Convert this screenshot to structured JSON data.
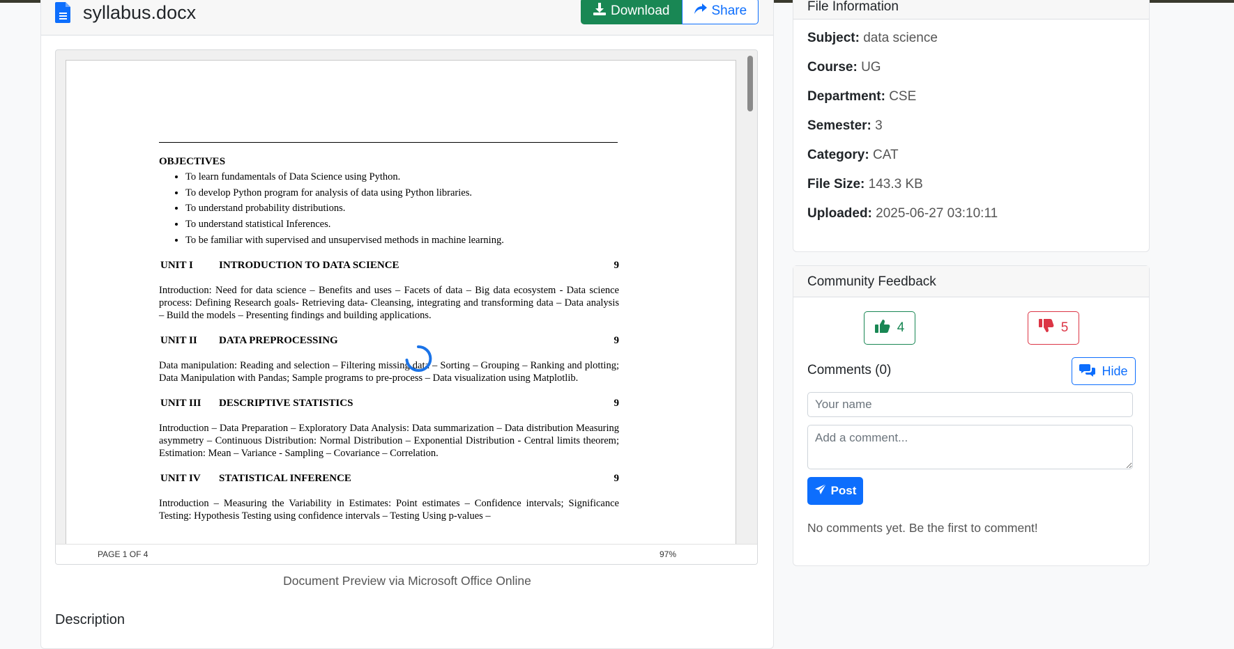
{
  "file": {
    "name": "syllabus.docx",
    "download_label": "Download",
    "share_label": "Share"
  },
  "document": {
    "objectives_title": "OBJECTIVES",
    "objectives": [
      "To learn fundamentals of Data Science using Python.",
      "To develop Python program for analysis of data using Python libraries.",
      "To understand probability distributions.",
      "To understand statistical Inferences.",
      "To be familiar with supervised and unsupervised methods in machine learning."
    ],
    "units": [
      {
        "number": "UNIT I",
        "title": "INTRODUCTION TO DATA SCIENCE",
        "hours": "9",
        "body": "Introduction: Need for data science – Benefits and uses – Facets of data – Big data ecosystem - Data science process: Defining Research goals- Retrieving data- Cleansing, integrating and transforming data – Data analysis – Build the models – Presenting findings and building applications."
      },
      {
        "number": "UNIT II",
        "title": "DATA PREPROCESSING",
        "hours": "9",
        "body": "Data manipulation: Reading and selection – Filtering missing data – Sorting – Grouping – Ranking and plotting; Data Manipulation with Pandas; Sample programs to pre-process – Data visualization using Matplotlib."
      },
      {
        "number": "UNIT III",
        "title": "DESCRIPTIVE STATISTICS",
        "hours": "9",
        "body": "Introduction – Data Preparation – Exploratory Data Analysis: Data summarization – Data distribution Measuring asymmetry – Continuous Distribution: Normal Distribution – Exponential Distribution - Central limits theorem; Estimation: Mean – Variance - Sampling – Covariance – Correlation."
      },
      {
        "number": "UNIT IV",
        "title": "STATISTICAL INFERENCE",
        "hours": "9",
        "body": "Introduction – Measuring the Variability in Estimates: Point estimates – Confidence intervals; Significance Testing: Hypothesis Testing using confidence intervals – Testing Using p-values –"
      }
    ]
  },
  "viewer": {
    "page_indicator": "PAGE 1 OF 4",
    "zoom": "97%",
    "preview_note": "Document Preview via Microsoft Office Online"
  },
  "description_heading": "Description",
  "file_info": {
    "header": "File Information",
    "rows": [
      {
        "label": "Subject:",
        "value": "data science"
      },
      {
        "label": "Course:",
        "value": "UG"
      },
      {
        "label": "Department:",
        "value": "CSE"
      },
      {
        "label": "Semester:",
        "value": "3"
      },
      {
        "label": "Category:",
        "value": "CAT"
      },
      {
        "label": "File Size:",
        "value": "143.3 KB"
      },
      {
        "label": "Uploaded:",
        "value": "2025-06-27 03:10:11"
      }
    ]
  },
  "feedback": {
    "header": "Community Feedback",
    "likes": "4",
    "dislikes": "5",
    "comments_label": "Comments (0)",
    "hide_label": "Hide",
    "name_placeholder": "Your name",
    "comment_placeholder": "Add a comment...",
    "post_label": "Post",
    "empty_message": "No comments yet. Be the first to comment!"
  },
  "colors": {
    "download": "#198754",
    "share": "#0d6efd",
    "like": "#198754",
    "dislike": "#dc3545",
    "post": "#0d6efd"
  }
}
